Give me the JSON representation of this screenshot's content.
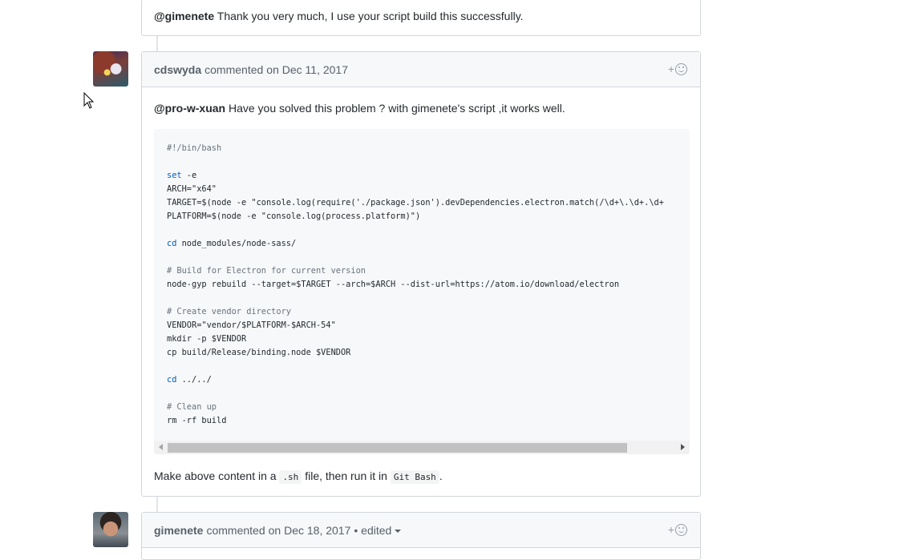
{
  "comment0": {
    "mention": "@gimenete",
    "text": " Thank you very much, I use your script build this successfully."
  },
  "comment1": {
    "author": "cdswyda",
    "action": "commented",
    "date": "on Dec 11, 2017",
    "reaction_label": "+",
    "mention": "@pro-w-xuan",
    "text": " Have you solved this problem ? with gimenete's script ,it works well.",
    "code_lines": [
      {
        "kind": "cm",
        "text": "#!/bin/bash"
      },
      {
        "kind": "plain",
        "text": ""
      },
      {
        "kind": "kw",
        "kw": "set",
        "text": " -e"
      },
      {
        "kind": "plain",
        "text": "ARCH=\"x64\""
      },
      {
        "kind": "plain",
        "text": "TARGET=$(node -e \"console.log(require('./package.json').devDependencies.electron.match(/\\d+\\.\\d+.\\d+"
      },
      {
        "kind": "plain",
        "text": "PLATFORM=$(node -e \"console.log(process.platform)\")"
      },
      {
        "kind": "plain",
        "text": ""
      },
      {
        "kind": "kw",
        "kw": "cd",
        "text": " node_modules/node-sass/"
      },
      {
        "kind": "plain",
        "text": ""
      },
      {
        "kind": "cm",
        "text": "# Build for Electron for current version"
      },
      {
        "kind": "plain",
        "text": "node-gyp rebuild --target=$TARGET --arch=$ARCH --dist-url=https://atom.io/download/electron"
      },
      {
        "kind": "plain",
        "text": ""
      },
      {
        "kind": "cm",
        "text": "# Create vendor directory"
      },
      {
        "kind": "plain",
        "text": "VENDOR=\"vendor/$PLATFORM-$ARCH-54\""
      },
      {
        "kind": "plain",
        "text": "mkdir -p $VENDOR"
      },
      {
        "kind": "plain",
        "text": "cp build/Release/binding.node $VENDOR"
      },
      {
        "kind": "plain",
        "text": ""
      },
      {
        "kind": "kw",
        "kw": "cd",
        "text": " ../../"
      },
      {
        "kind": "plain",
        "text": ""
      },
      {
        "kind": "cm",
        "text": "# Clean up"
      },
      {
        "kind": "plain",
        "text": "rm -rf build"
      }
    ],
    "footer": {
      "pre": "Make above content in a ",
      "code1": ".sh",
      "mid": " file, then run it in ",
      "code2": "Git Bash",
      "post": "."
    }
  },
  "comment2": {
    "author": "gimenete",
    "action": "commented",
    "date": "on Dec 18, 2017",
    "edited": "• edited",
    "reaction_label": "+"
  }
}
